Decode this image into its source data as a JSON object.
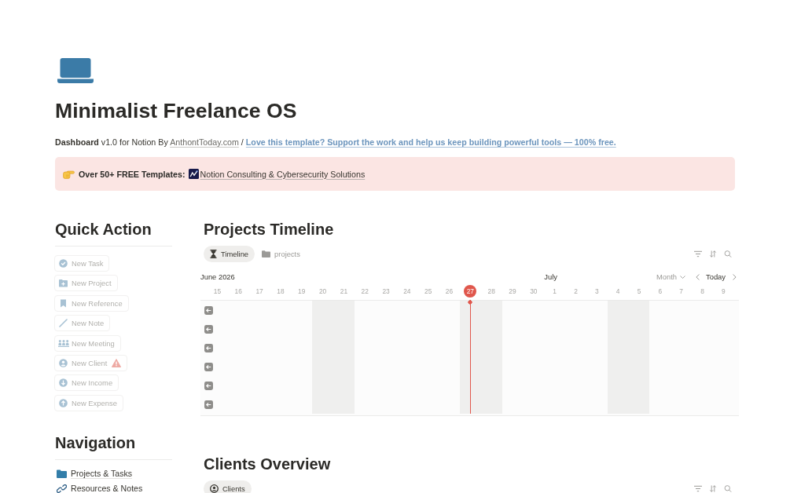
{
  "page": {
    "title": "Minimalist Freelance OS"
  },
  "byline": [
    {
      "kind": "text",
      "text": "**Dashboard** v1.0 for Notion By"
    },
    {
      "kind": "link",
      "text": "AnthontToday.com"
    },
    {
      "kind": "text",
      "text": "/"
    },
    {
      "kind": "promo_link",
      "text": "Love this template? Support the work and help us keep building powerful tools — 100% free."
    }
  ],
  "callout": {
    "label": "Over 50+ FREE Templates:",
    "link": "Notion Consulting & Cybersecurity Solutions"
  },
  "quick_actions": {
    "title": "Quick Action",
    "buttons": [
      {
        "label": "New Task",
        "warning": false
      },
      {
        "label": "New Project",
        "warning": false
      },
      {
        "label": "New Reference",
        "warning": false
      },
      {
        "label": "New Note",
        "warning": false
      },
      {
        "label": "New Meeting",
        "warning": false
      },
      {
        "label": "New Client",
        "warning": true
      },
      {
        "label": "New Income",
        "warning": false
      },
      {
        "label": "New Expense",
        "warning": false
      }
    ]
  },
  "navigation": {
    "title": "Navigation",
    "items": [
      {
        "label": "Projects & Tasks"
      },
      {
        "label": "Resources & Notes"
      }
    ]
  },
  "timeline": {
    "title": "Projects Timeline",
    "views": [
      {
        "label": "Timeline",
        "selected": true
      },
      {
        "label": "projects",
        "selected": false
      }
    ],
    "range": "Month",
    "today_button": "Today",
    "months": [
      {
        "label": "June 2026",
        "days": [
          {
            "label": "15",
            "weekend": false,
            "today": false
          },
          {
            "label": "16",
            "weekend": false,
            "today": false
          },
          {
            "label": "17",
            "weekend": false,
            "today": false
          },
          {
            "label": "18",
            "weekend": false,
            "today": false
          },
          {
            "label": "19",
            "weekend": false,
            "today": false
          },
          {
            "label": "20",
            "weekend": true,
            "today": false
          },
          {
            "label": "21",
            "weekend": true,
            "today": false
          },
          {
            "label": "22",
            "weekend": false,
            "today": false
          },
          {
            "label": "23",
            "weekend": false,
            "today": false
          },
          {
            "label": "24",
            "weekend": false,
            "today": false
          },
          {
            "label": "25",
            "weekend": false,
            "today": false
          },
          {
            "label": "26",
            "weekend": false,
            "today": false
          },
          {
            "label": "27",
            "weekend": true,
            "today": true
          },
          {
            "label": "28",
            "weekend": true,
            "today": false
          },
          {
            "label": "29",
            "weekend": false,
            "today": false
          },
          {
            "label": "30",
            "weekend": false,
            "today": false
          }
        ]
      },
      {
        "label": "July",
        "days": [
          {
            "label": "1",
            "weekend": false,
            "today": false
          },
          {
            "label": "2",
            "weekend": false,
            "today": false
          },
          {
            "label": "3",
            "weekend": false,
            "today": false
          },
          {
            "label": "4",
            "weekend": true,
            "today": false
          },
          {
            "label": "5",
            "weekend": true,
            "today": false
          },
          {
            "label": "6",
            "weekend": false,
            "today": false
          },
          {
            "label": "7",
            "weekend": false,
            "today": false
          },
          {
            "label": "8",
            "weekend": false,
            "today": false
          },
          {
            "label": "9",
            "weekend": false,
            "today": false
          }
        ]
      }
    ],
    "rows": [
      {
        "kind": "earlier"
      },
      {
        "kind": "earlier"
      },
      {
        "kind": "earlier"
      },
      {
        "kind": "earlier"
      },
      {
        "kind": "earlier"
      },
      {
        "kind": "earlier"
      }
    ]
  },
  "clients": {
    "title": "Clients Overview",
    "views": [
      {
        "label": "Clients",
        "selected": true
      }
    ]
  }
}
